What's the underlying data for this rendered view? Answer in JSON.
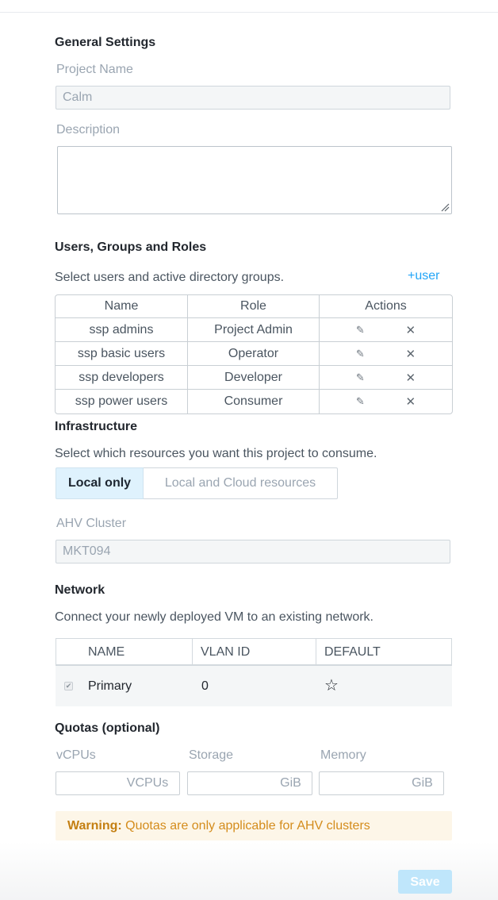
{
  "general": {
    "title": "General Settings",
    "project_name_label": "Project Name",
    "project_name_value": "Calm",
    "description_label": "Description",
    "description_value": ""
  },
  "users": {
    "title": "Users, Groups and Roles",
    "helper": "Select users and active directory groups.",
    "add_user_label": "+user",
    "columns": [
      "Name",
      "Role",
      "Actions"
    ],
    "rows": [
      {
        "name": "ssp admins",
        "role": "Project Admin"
      },
      {
        "name": "ssp basic users",
        "role": "Operator"
      },
      {
        "name": "ssp developers",
        "role": "Developer"
      },
      {
        "name": "ssp power users",
        "role": "Consumer"
      }
    ],
    "icons": {
      "edit": "pencil-icon",
      "remove": "close-icon"
    }
  },
  "infrastructure": {
    "title": "Infrastructure",
    "helper": "Select which resources you want this project to consume.",
    "options": [
      "Local only",
      "Local and Cloud resources"
    ],
    "selected": "Local only",
    "cluster_label": "AHV Cluster",
    "cluster_value": "MKT094"
  },
  "network": {
    "title": "Network",
    "helper": "Connect your newly deployed VM to an existing network.",
    "columns": [
      "NAME",
      "VLAN ID",
      "DEFAULT"
    ],
    "rows": [
      {
        "checked": true,
        "name": "Primary",
        "vlan_id": "0",
        "default_icon": "star-outline-icon"
      }
    ]
  },
  "quotas": {
    "title": "Quotas (optional)",
    "fields": [
      {
        "label": "vCPUs",
        "value": "",
        "unit": "VCPUs"
      },
      {
        "label": "Storage",
        "value": "",
        "unit": "GiB"
      },
      {
        "label": "Memory",
        "value": "",
        "unit": "GiB"
      }
    ],
    "warning_prefix": "Warning:",
    "warning_text": " Quotas are only applicable for AHV clusters"
  },
  "footer": {
    "save_label": "Save"
  },
  "colors": {
    "accent": "#22a5f7",
    "selected_bg": "#dff2fd",
    "warning_bg": "#fdf6e8",
    "warning_text": "#d48c1c",
    "save_disabled_bg": "#bfe6fb"
  }
}
